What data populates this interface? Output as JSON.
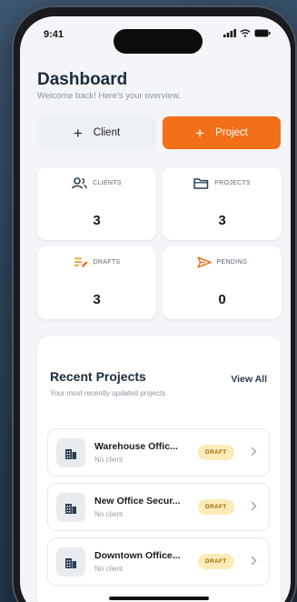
{
  "status": {
    "time": "9:41"
  },
  "header": {
    "title": "Dashboard",
    "subtitle": "Welcome back! Here's your overview."
  },
  "actions": {
    "client_label": "Client",
    "project_label": "Project",
    "plus": "+"
  },
  "stats": [
    {
      "label": "CLIENTS",
      "value": "3",
      "icon": "users-icon"
    },
    {
      "label": "PROJECTS",
      "value": "3",
      "icon": "folder-icon"
    },
    {
      "label": "DRAFTS",
      "value": "3",
      "icon": "drafts-icon"
    },
    {
      "label": "PENDING",
      "value": "0",
      "icon": "send-icon"
    }
  ],
  "recent": {
    "title": "Recent Projects",
    "subtitle": "Your most recently updated projects",
    "view_all": "View All",
    "items": [
      {
        "name": "Warehouse Offic...",
        "client": "No client",
        "status": "DRAFT"
      },
      {
        "name": "New Office Secur...",
        "client": "No client",
        "status": "DRAFT"
      },
      {
        "name": "Downtown Office...",
        "client": "No client",
        "status": "DRAFT"
      }
    ]
  },
  "colors": {
    "accent": "#f36f18",
    "badge_bg": "#fcebb8",
    "badge_text": "#9a6a08"
  }
}
